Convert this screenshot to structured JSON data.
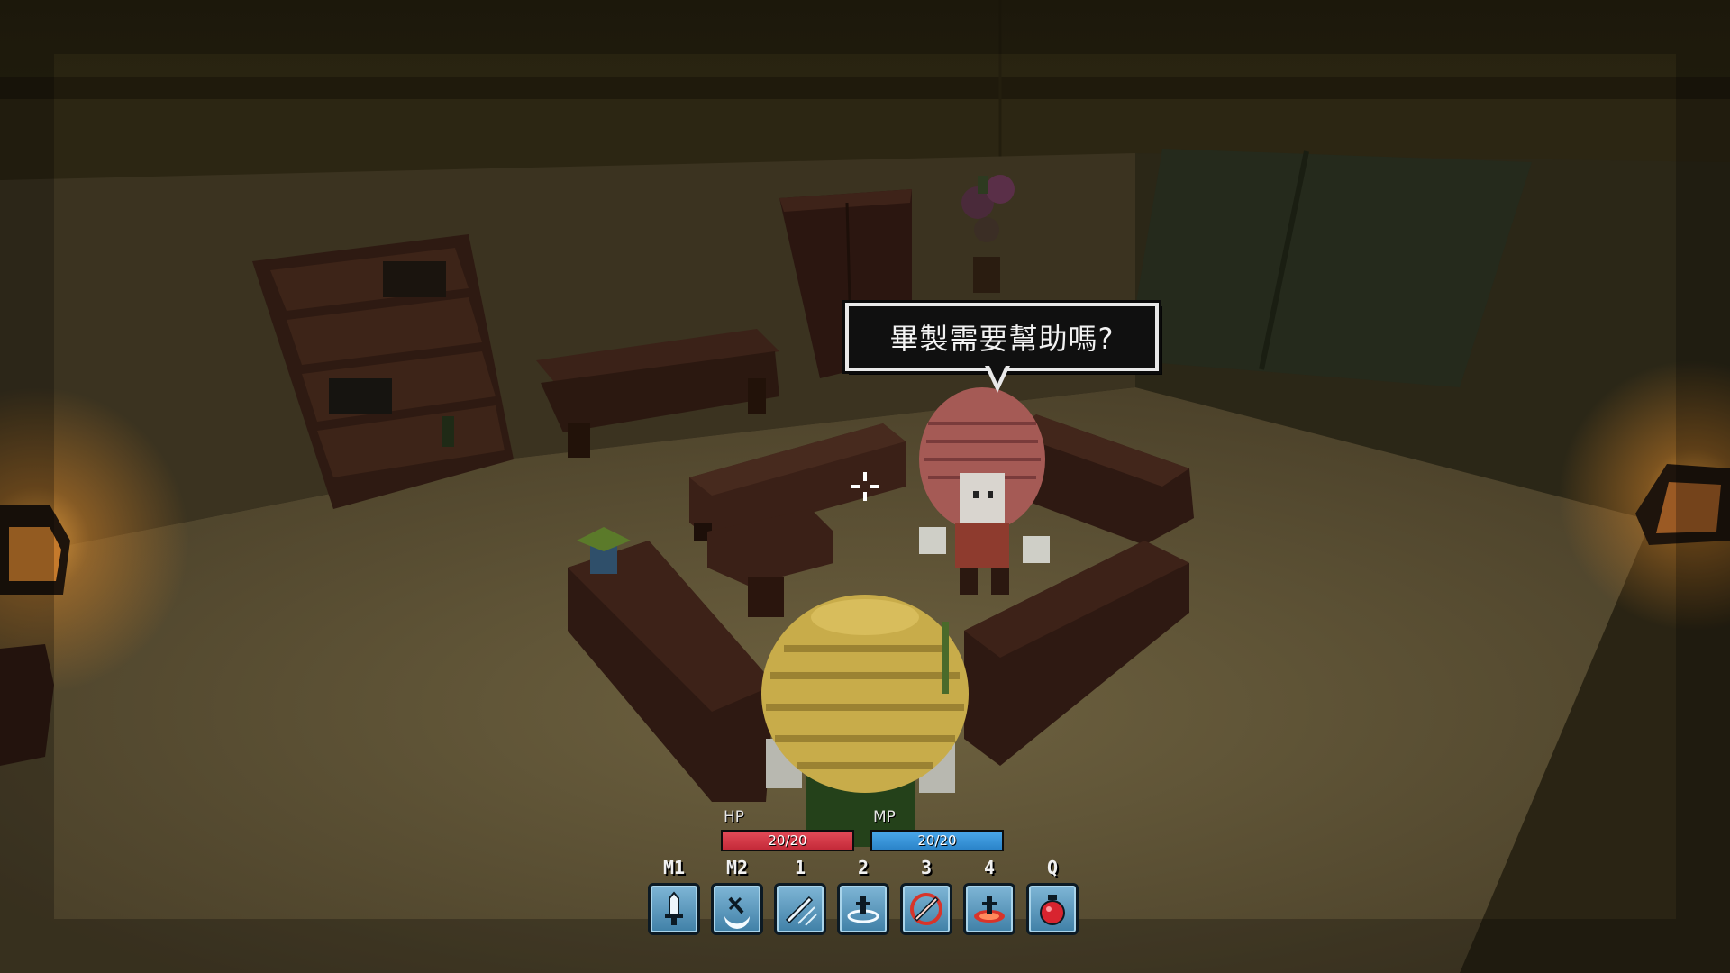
{
  "npc_dialogue": {
    "text": "畢製需要幫助嗎?"
  },
  "hud": {
    "hp": {
      "label": "HP",
      "value_text": "20/20",
      "current": 20,
      "max": 20,
      "color": "#d93a48"
    },
    "mp": {
      "label": "MP",
      "value_text": "20/20",
      "current": 20,
      "max": 20,
      "color": "#3796dc"
    },
    "skills": [
      {
        "hotkey": "M1",
        "icon": "sword-icon"
      },
      {
        "hotkey": "M2",
        "icon": "crescent-slash-icon"
      },
      {
        "hotkey": "1",
        "icon": "dash-blade-icon"
      },
      {
        "hotkey": "2",
        "icon": "ground-stab-icon"
      },
      {
        "hotkey": "3",
        "icon": "fire-blade-icon"
      },
      {
        "hotkey": "4",
        "icon": "fire-stab-icon"
      },
      {
        "hotkey": "Q",
        "icon": "potion-bag-icon"
      }
    ]
  },
  "colors": {
    "floor": "#5e5236",
    "wall": "#3a3220",
    "lamp_glow": "#ffb347",
    "furniture": "#3a1f16"
  }
}
